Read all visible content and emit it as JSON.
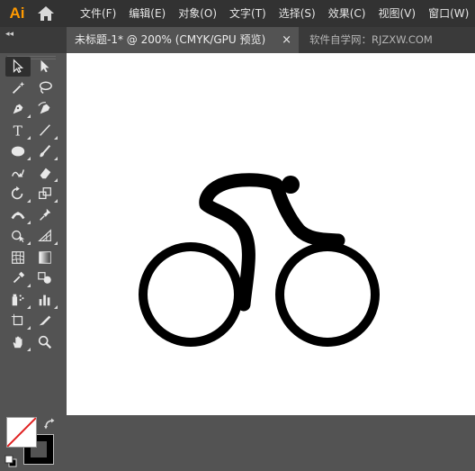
{
  "app": {
    "logo": "Ai"
  },
  "menu": [
    "文件(F)",
    "编辑(E)",
    "对象(O)",
    "文字(T)",
    "选择(S)",
    "效果(C)",
    "视图(V)",
    "窗口(W)"
  ],
  "document_tab": {
    "title": "未标题-1* @ 200% (CMYK/GPU 预览)",
    "close_label": "×"
  },
  "watermark": "软件自学网：RJZXW.COM",
  "panel_collapse": "◂◂",
  "tools": [
    {
      "name": "selection-tool",
      "icon": "selection-arrow-icon",
      "active": true
    },
    {
      "name": "direct-selection-tool",
      "icon": "direct-selection-arrow-icon"
    },
    {
      "name": "magic-wand-tool",
      "icon": "magic-wand-icon"
    },
    {
      "name": "lasso-tool",
      "icon": "lasso-icon"
    },
    {
      "name": "pen-tool",
      "icon": "pen-icon"
    },
    {
      "name": "curvature-tool",
      "icon": "curvature-pen-icon"
    },
    {
      "name": "type-tool",
      "icon": "type-icon"
    },
    {
      "name": "line-segment-tool",
      "icon": "line-segment-icon"
    },
    {
      "name": "ellipse-tool",
      "icon": "ellipse-icon"
    },
    {
      "name": "paintbrush-tool",
      "icon": "paintbrush-icon"
    },
    {
      "name": "shaper-tool",
      "icon": "shaper-icon"
    },
    {
      "name": "eraser-tool",
      "icon": "eraser-icon"
    },
    {
      "name": "rotate-tool",
      "icon": "rotate-icon"
    },
    {
      "name": "scale-tool",
      "icon": "scale-icon"
    },
    {
      "name": "width-tool",
      "icon": "width-icon"
    },
    {
      "name": "puppet-warp-tool",
      "icon": "puppet-warp-pin-icon"
    },
    {
      "name": "shape-builder-tool",
      "icon": "shape-builder-icon"
    },
    {
      "name": "perspective-grid-tool",
      "icon": "perspective-grid-icon"
    },
    {
      "name": "mesh-tool",
      "icon": "mesh-icon"
    },
    {
      "name": "gradient-tool",
      "icon": "gradient-icon"
    },
    {
      "name": "eyedropper-tool",
      "icon": "eyedropper-icon"
    },
    {
      "name": "blend-tool",
      "icon": "blend-icon"
    },
    {
      "name": "symbol-sprayer-tool",
      "icon": "symbol-sprayer-icon"
    },
    {
      "name": "column-graph-tool",
      "icon": "column-graph-icon"
    },
    {
      "name": "artboard-tool",
      "icon": "artboard-icon"
    },
    {
      "name": "slice-tool",
      "icon": "slice-knife-icon"
    },
    {
      "name": "hand-tool",
      "icon": "hand-icon"
    },
    {
      "name": "zoom-tool",
      "icon": "zoom-magnifier-icon"
    }
  ],
  "colors": {
    "fill": "#ffffff",
    "stroke": "#000000",
    "none_slash": "#e02020",
    "menubar_bg": "#323232",
    "panel_bg": "#535353",
    "artboard": "#ffffff",
    "artwork": "#000000",
    "logo": "#ff9a00"
  }
}
